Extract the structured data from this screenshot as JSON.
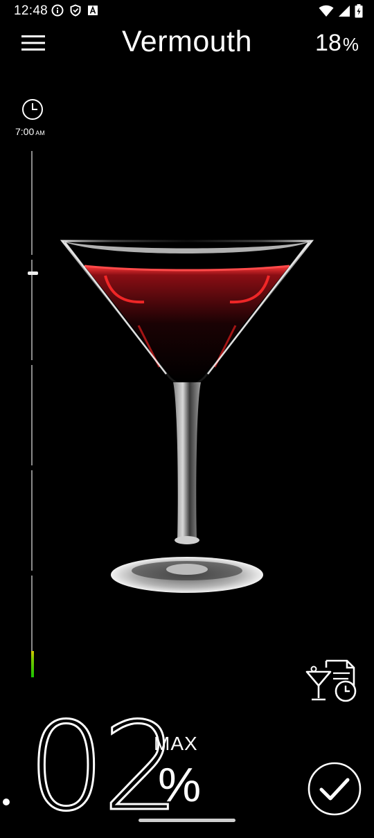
{
  "status_bar": {
    "time": "12:48",
    "icons_left": [
      "info-icon",
      "shield-icon",
      "a-badge-icon"
    ],
    "icons_right": [
      "wifi-icon",
      "signal-icon",
      "battery-charging-icon"
    ]
  },
  "app_bar": {
    "title": "Vermouth",
    "abv_value": "18",
    "abv_unit": "%",
    "menu_icon": "hamburger-menu-icon"
  },
  "timeline": {
    "start_time": "7:00",
    "start_ampm": "AM",
    "level_colors": [
      "#d6c800",
      "#18c400"
    ]
  },
  "drink": {
    "glass": "martini-glass",
    "liquid_color": "#e0202a"
  },
  "bac": {
    "value": "02",
    "max_label": "MAX",
    "unit": "%"
  },
  "actions": {
    "history_icon": "drink-history-icon",
    "confirm_icon": "checkmark-circle-icon"
  }
}
